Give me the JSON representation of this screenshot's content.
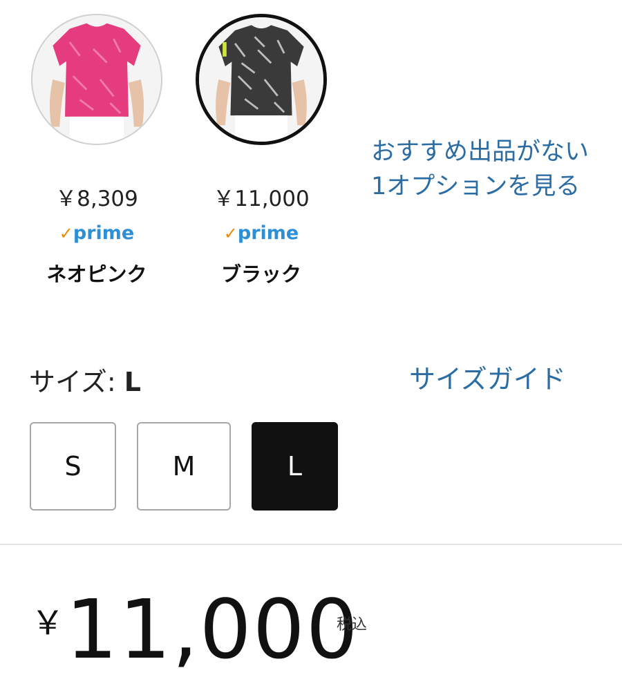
{
  "swatches": [
    {
      "price": "￥8,309",
      "prime_check": "✓",
      "prime_label": "prime",
      "color_name": "ネオピンク",
      "selected": false
    },
    {
      "price": "￥11,000",
      "prime_check": "✓",
      "prime_label": "prime",
      "color_name": "ブラック",
      "selected": true
    }
  ],
  "recommend": {
    "line1": "おすすめ出品がない",
    "line2": "1オプションを見る"
  },
  "size": {
    "label": "サイズ: ",
    "value": "L",
    "guide_link": "サイズガイド",
    "options": [
      "S",
      "M",
      "L"
    ],
    "selected": "L"
  },
  "price": {
    "currency": "￥",
    "amount": "11,000",
    "tax_note": "税込"
  },
  "colors": {
    "link": "#2b6ca3",
    "prime_blue": "#2d8fd5",
    "prime_check": "#f08804",
    "selected": "#111111"
  }
}
